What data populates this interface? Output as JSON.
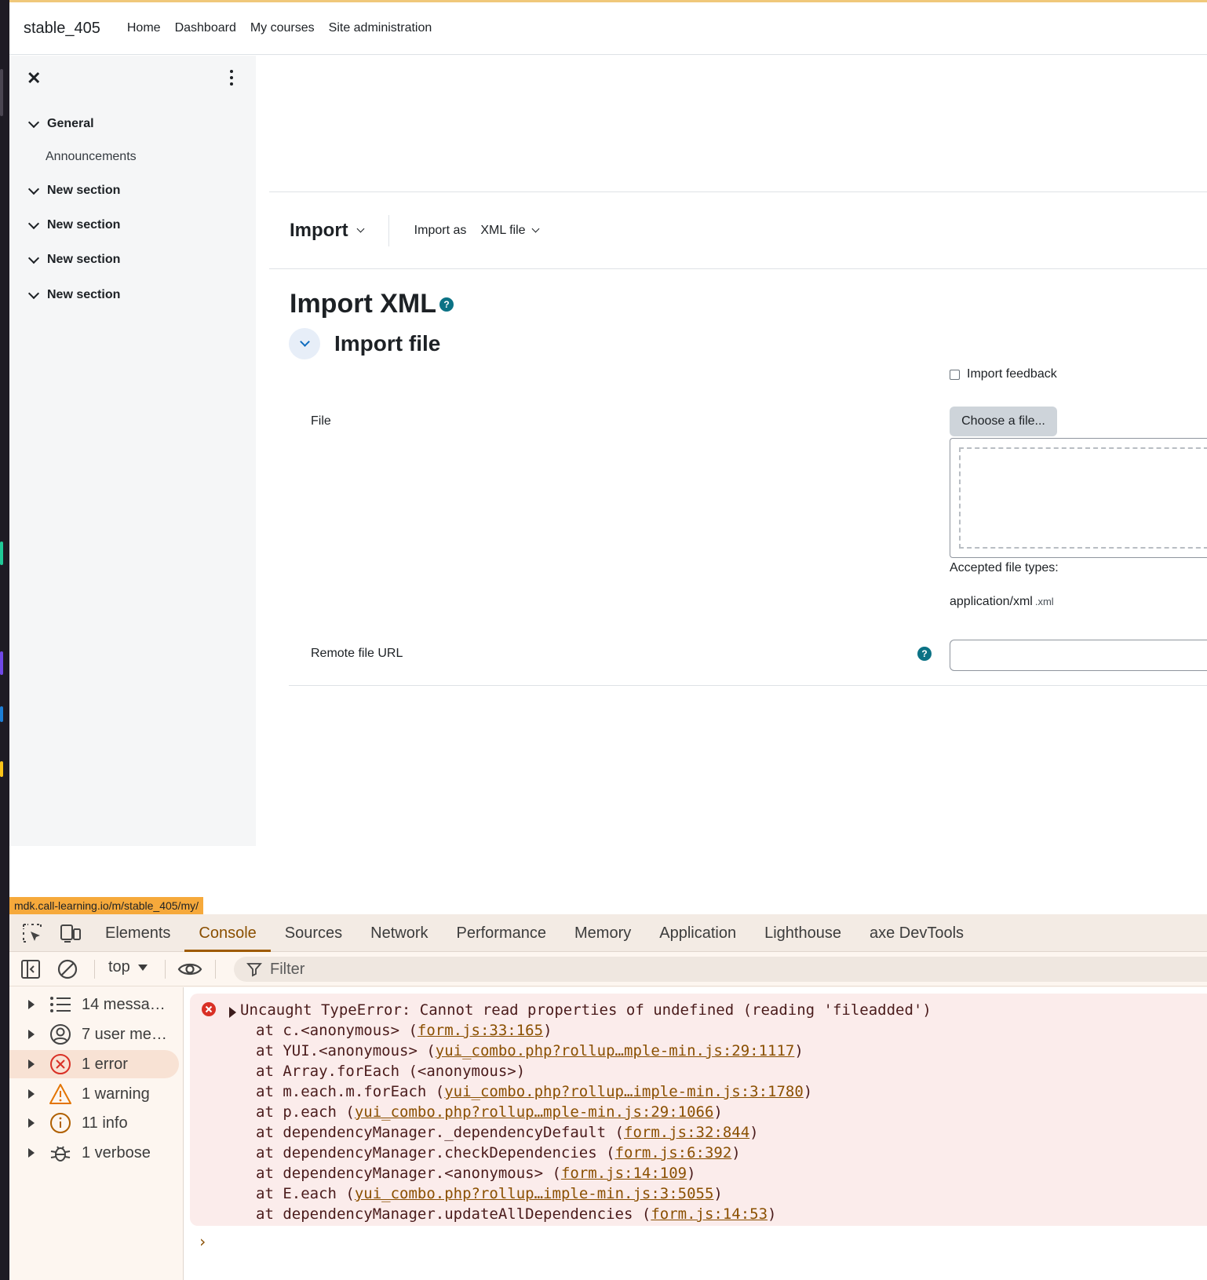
{
  "navbar": {
    "brand": "stable_405",
    "links": [
      "Home",
      "Dashboard",
      "My courses",
      "Site administration"
    ]
  },
  "drawer": {
    "sections": [
      {
        "label": "General"
      },
      {
        "label": "New section"
      },
      {
        "label": "New section"
      },
      {
        "label": "New section"
      },
      {
        "label": "New section"
      }
    ],
    "sub_items": [
      "Announcements"
    ]
  },
  "tertiary": {
    "import_label": "Import",
    "import_as_label": "Import as",
    "import_as_value": "XML file"
  },
  "page": {
    "title": "Import XML",
    "section_title": "Import file",
    "import_feedback_label": "Import feedback",
    "file_label": "File",
    "choose_button": "Choose a file...",
    "accepted_label": "Accepted file types:",
    "accepted_type": "application/xml",
    "accepted_ext": ".xml",
    "remote_url_label": "Remote file URL",
    "remote_url_value": ""
  },
  "status_url": "mdk.call-learning.io/m/stable_405/my/",
  "devtools": {
    "tabs": [
      "Elements",
      "Console",
      "Sources",
      "Network",
      "Performance",
      "Memory",
      "Application",
      "Lighthouse",
      "axe DevTools"
    ],
    "active_tab": "Console",
    "context": "top",
    "filter_placeholder": "Filter",
    "sidebar": [
      {
        "label": "14 messa…",
        "icon": "list-icon"
      },
      {
        "label": "7 user me…",
        "icon": "user-icon"
      },
      {
        "label": "1 error",
        "icon": "error-icon"
      },
      {
        "label": "1 warning",
        "icon": "warning-icon"
      },
      {
        "label": "11 info",
        "icon": "info-icon"
      },
      {
        "label": "1 verbose",
        "icon": "bug-icon"
      }
    ],
    "error": {
      "message": "Uncaught TypeError: Cannot read properties of undefined (reading 'fileadded')",
      "stack": [
        {
          "prefix": "at c.<anonymous> (",
          "link": "form.js:33:165",
          "suffix": ")"
        },
        {
          "prefix": "at YUI.<anonymous> (",
          "link": "yui_combo.php?rollup…mple-min.js:29:1117",
          "suffix": ")"
        },
        {
          "prefix": "at Array.forEach (<anonymous>)",
          "link": "",
          "suffix": ""
        },
        {
          "prefix": "at m.each.m.forEach (",
          "link": "yui_combo.php?rollup…imple-min.js:3:1780",
          "suffix": ")"
        },
        {
          "prefix": "at p.each (",
          "link": "yui_combo.php?rollup…mple-min.js:29:1066",
          "suffix": ")"
        },
        {
          "prefix": "at dependencyManager._dependencyDefault (",
          "link": "form.js:32:844",
          "suffix": ")"
        },
        {
          "prefix": "at dependencyManager.checkDependencies (",
          "link": "form.js:6:392",
          "suffix": ")"
        },
        {
          "prefix": "at dependencyManager.<anonymous> (",
          "link": "form.js:14:109",
          "suffix": ")"
        },
        {
          "prefix": "at E.each (",
          "link": "yui_combo.php?rollup…imple-min.js:3:5055",
          "suffix": ")"
        },
        {
          "prefix": "at dependencyManager.updateAllDependencies (",
          "link": "form.js:14:53",
          "suffix": ")"
        }
      ]
    },
    "colors": {
      "accent": "#9e5a00",
      "error_bg": "#fbeceb",
      "error_red": "#d93025",
      "warning": "#e37400"
    }
  }
}
